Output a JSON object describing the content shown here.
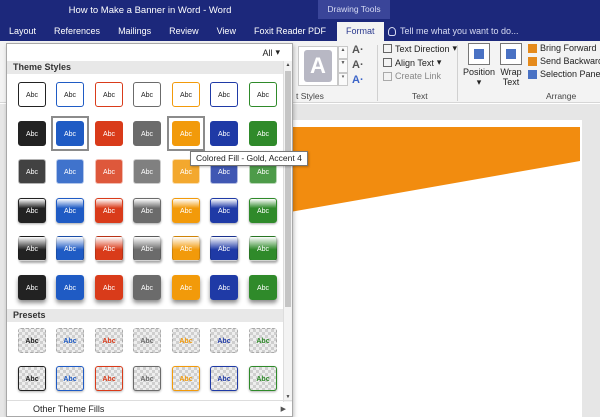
{
  "window": {
    "title": "How to Make a Banner in Word - Word",
    "context_label": "Drawing Tools"
  },
  "tabs": [
    {
      "label": "Layout",
      "active": false
    },
    {
      "label": "References",
      "active": false
    },
    {
      "label": "Mailings",
      "active": false
    },
    {
      "label": "Review",
      "active": false
    },
    {
      "label": "View",
      "active": false
    },
    {
      "label": "Foxit Reader PDF",
      "active": false
    },
    {
      "label": "Format",
      "active": true
    }
  ],
  "tellme": {
    "placeholder": "Tell me what you want to do..."
  },
  "ribbon": {
    "wordart_styles_label": "t Styles",
    "text_group": {
      "label": "Text",
      "text_direction": "Text Direction",
      "align_text": "Align Text",
      "create_link": "Create Link"
    },
    "arrange_group": {
      "label": "Arrange",
      "position": "Position",
      "wrap_text": "Wrap Text",
      "bring_forward": "Bring Forward",
      "send_backward": "Send Backward",
      "selection_pane": "Selection Pane"
    }
  },
  "panel": {
    "filter_label": "All",
    "theme_styles_header": "Theme Styles",
    "presets_header": "Presets",
    "footer_label": "Other Theme Fills",
    "swatch_text": "Abc",
    "colors": [
      "#222222",
      "#1f5bc4",
      "#d93b1a",
      "#6b6b6b",
      "#f29a0a",
      "#1f3aa6",
      "#2f8a2a"
    ],
    "selected": [
      {
        "row": 1,
        "col": 1
      },
      {
        "row": 1,
        "col": 4
      }
    ],
    "tooltip": "Colored Fill - Gold, Accent 4"
  }
}
